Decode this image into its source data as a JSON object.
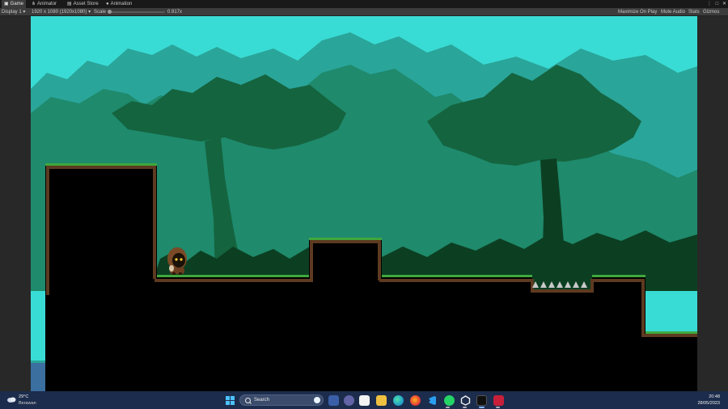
{
  "editor": {
    "tabs": [
      {
        "label": "Game",
        "icon": "game-icon",
        "active": true
      },
      {
        "label": "Animator",
        "icon": "animator-icon",
        "active": false
      },
      {
        "label": "Asset Store",
        "icon": "asset-store-icon",
        "active": false
      },
      {
        "label": "Animation",
        "icon": "animation-icon",
        "active": false
      }
    ],
    "toolbar": {
      "display": "Display 1",
      "resolution": "1920 x 1080 (1920x1080)",
      "scale_label": "Scale",
      "scale_value": "0.917x",
      "maximize_on_play": "Maximize On Play",
      "mute_audio": "Mute Audio",
      "stats": "Stats",
      "gizmos": "Gizmos"
    }
  },
  "game": {
    "sky_color": "#39dcd4",
    "foliage_colors": [
      "#2aa59a",
      "#1f8a6c",
      "#14643f",
      "#0c3f22"
    ],
    "ground_color": "#000000",
    "grass_color": "#3fa83d",
    "dirt_color": "#5d3a20"
  },
  "taskbar": {
    "weather_temp": "29°C",
    "weather_desc": "Berawan",
    "search_placeholder": "Search",
    "time": "20:48",
    "date": "28/05/2023",
    "apps": [
      "start-icon",
      "search-icon",
      "widgets-icon",
      "teams-icon",
      "store-icon",
      "edge-icon",
      "file-explorer-icon",
      "firefox-icon",
      "vscode-icon",
      "whatsapp-icon",
      "unity-icon",
      "terminal-icon",
      "app-red-icon"
    ]
  }
}
